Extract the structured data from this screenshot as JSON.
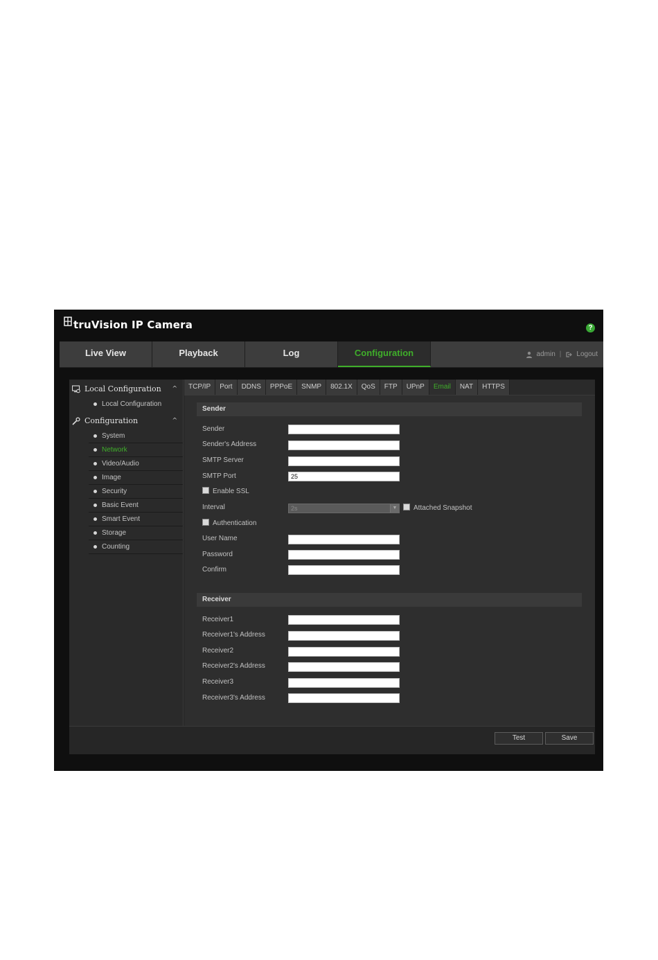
{
  "header": {
    "brand": "truVision  IP Camera",
    "help_symbol": "?"
  },
  "nav": {
    "tabs": [
      {
        "label": "Live View"
      },
      {
        "label": "Playback"
      },
      {
        "label": "Log"
      },
      {
        "label": "Configuration"
      }
    ],
    "active": "Configuration",
    "user": "admin",
    "separator": "|",
    "logout": "Logout"
  },
  "sidebar": {
    "local_section": "Local Configuration",
    "local_items": [
      {
        "label": "Local Configuration"
      }
    ],
    "config_section": "Configuration",
    "config_items": [
      {
        "label": "System"
      },
      {
        "label": "Network"
      },
      {
        "label": "Video/Audio"
      },
      {
        "label": "Image"
      },
      {
        "label": "Security"
      },
      {
        "label": "Basic Event"
      },
      {
        "label": "Smart Event"
      },
      {
        "label": "Storage"
      },
      {
        "label": "Counting"
      }
    ],
    "active_item": "Network",
    "chevron": "^"
  },
  "subtabs": [
    "TCP/IP",
    "Port",
    "DDNS",
    "PPPoE",
    "SNMP",
    "802.1X",
    "QoS",
    "FTP",
    "UPnP",
    "Email",
    "NAT",
    "HTTPS"
  ],
  "active_subtab": "Email",
  "sender": {
    "title": "Sender",
    "sender_label": "Sender",
    "sender_value": "",
    "address_label": "Sender's Address",
    "address_value": "",
    "smtp_server_label": "SMTP Server",
    "smtp_server_value": "",
    "smtp_port_label": "SMTP Port",
    "smtp_port_value": "25",
    "ssl_label": "Enable SSL",
    "interval_label": "Interval",
    "interval_value": "2s",
    "snapshot_label": "Attached Snapshot",
    "auth_label": "Authentication",
    "username_label": "User Name",
    "password_label": "Password",
    "confirm_label": "Confirm"
  },
  "receiver": {
    "title": "Receiver",
    "r1_label": "Receiver1",
    "r1_addr_label": "Receiver1's Address",
    "r2_label": "Receiver2",
    "r2_addr_label": "Receiver2's Address",
    "r3_label": "Receiver3",
    "r3_addr_label": "Receiver3's Address"
  },
  "buttons": {
    "test": "Test",
    "save": "Save"
  },
  "colors": {
    "accent": "#3fae2a",
    "background": "#0f0f0f"
  }
}
